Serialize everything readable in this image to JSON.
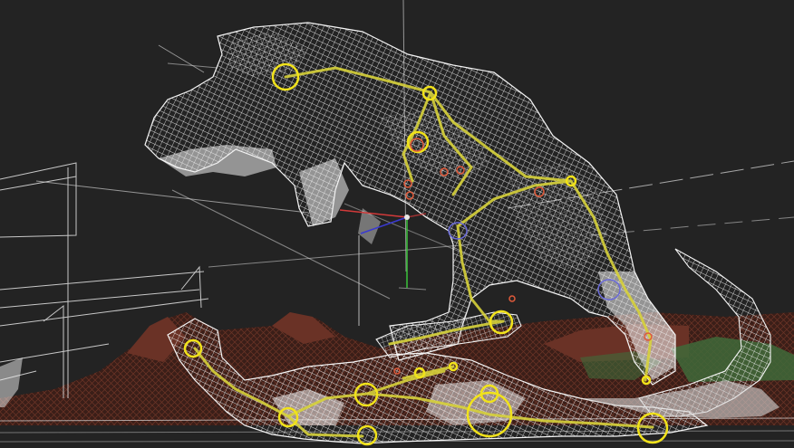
{
  "viewport": {
    "mode": "wireframe",
    "background_color": "#232323"
  },
  "colors": {
    "mesh_wire": "#f2f2f2",
    "rig_bone": "#d7d23a",
    "rig_joint": "#f1e21a",
    "ik_marker": "#e05a3a",
    "control_ring": "#6a6ad8",
    "grid_line": "#e6e6e6",
    "terrain_dark": "#5a2b20",
    "terrain_light": "#7a3a2a",
    "foliage": "#3f6a3a",
    "axis_x": "#d23a3a",
    "axis_y": "#3ac23a",
    "axis_z": "#3a3ad2"
  },
  "objects": [
    {
      "name": "trex-standing",
      "icon": "trex-mesh-icon"
    },
    {
      "name": "dinosaur-lying",
      "icon": "prey-mesh-icon"
    },
    {
      "name": "transform-gizmo",
      "icon": "axis-gizmo-icon"
    }
  ]
}
